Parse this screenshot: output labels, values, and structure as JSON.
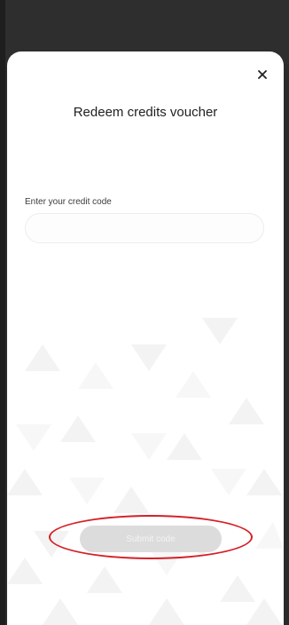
{
  "modal": {
    "title": "Redeem credits voucher",
    "close_icon": "close-icon",
    "code_label": "Enter your credit code",
    "code_value": "",
    "code_placeholder": "",
    "submit_label": "Submit code"
  },
  "colors": {
    "backdrop": "#2b2b2b",
    "sheet": "#ffffff",
    "button_disabled": "#dcdcdc",
    "annotation_ring": "#d51f26"
  }
}
